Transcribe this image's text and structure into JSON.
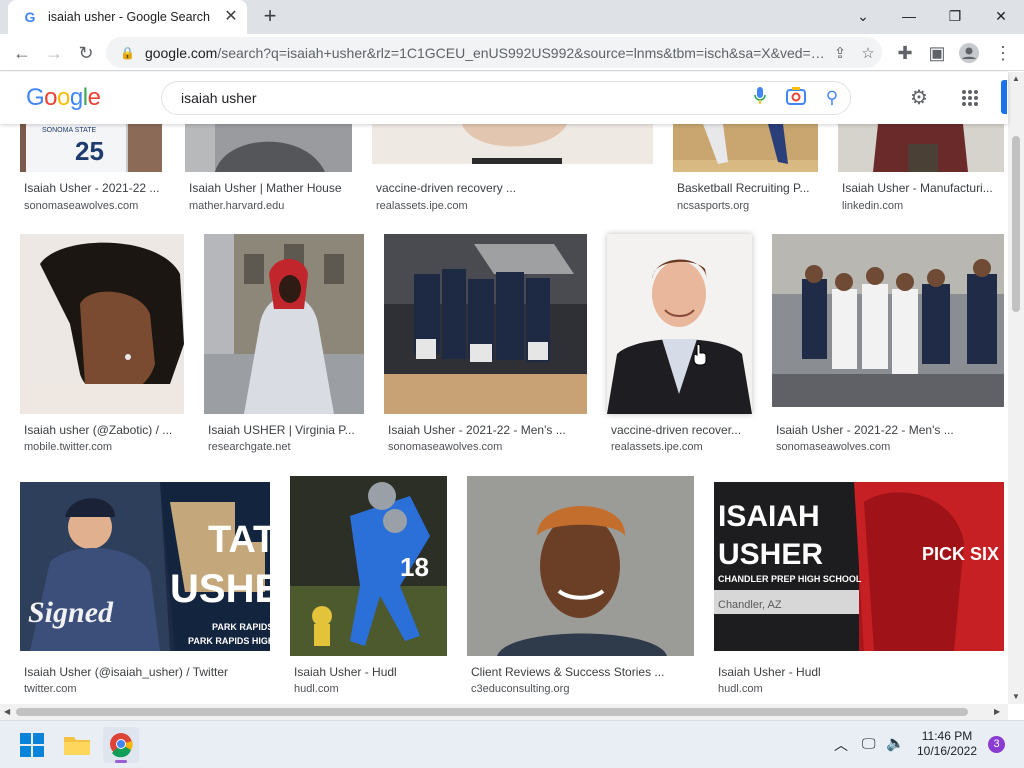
{
  "browser": {
    "tab_title": "isaiah usher - Google Search",
    "tab_close": "✕",
    "new_tab": "+",
    "address_domain": "google.com",
    "address_rest": "/search?q=isaiah+usher&rlz=1C1GCEU_enUS992US992&source=lnms&tbm=isch&sa=X&ved=…"
  },
  "google": {
    "query": "isaiah usher"
  },
  "results": {
    "row1": [
      {
        "title": "Isaiah Usher - 2021-22 ...",
        "source": "sonomaseawolves.com"
      },
      {
        "title": "Isaiah Usher | Mather House",
        "source": "mather.harvard.edu"
      },
      {
        "title": "vaccine-driven recovery ...",
        "source": "realassets.ipe.com"
      },
      {
        "title": "Basketball Recruiting P...",
        "source": "ncsasports.org"
      },
      {
        "title": "Isaiah Usher - Manufacturi...",
        "source": "linkedin.com"
      }
    ],
    "row2": [
      {
        "title": "Isaiah usher (@Zabotic) / ...",
        "source": "mobile.twitter.com"
      },
      {
        "title": "Isaiah USHER | Virginia P...",
        "source": "researchgate.net"
      },
      {
        "title": "Isaiah Usher - 2021-22 - Men's ...",
        "source": "sonomaseawolves.com"
      },
      {
        "title": "vaccine-driven recover...",
        "source": "realassets.ipe.com"
      },
      {
        "title": "Isaiah Usher - 2021-22 - Men's ...",
        "source": "sonomaseawolves.com"
      }
    ],
    "row3": [
      {
        "title": "Isaiah Usher (@isaiah_usher) / Twitter",
        "source": "twitter.com"
      },
      {
        "title": "Isaiah Usher - Hudl",
        "source": "hudl.com"
      },
      {
        "title": "Client Reviews & Success Stories ...",
        "source": "c3educonsulting.org"
      },
      {
        "title": "Isaiah Usher - Hudl",
        "source": "hudl.com"
      }
    ]
  },
  "image_text": {
    "jersey_number": "25",
    "jersey_school": "SONOMA STATE",
    "tate": "TAT",
    "usher_big": "USHE",
    "signed": "Signed",
    "park_rapids": "PARK RAPIDS",
    "park_rapids_high": "PARK RAPIDS HIGH S",
    "jersey_18": "18",
    "isaiah": "ISAIAH",
    "usher": "USHER",
    "chandler": "CHANDLER PREP HIGH SCHOOL",
    "chandler_az": "Chandler, AZ",
    "pick_six": "PICK SIX"
  },
  "taskbar": {
    "time": "11:46 PM",
    "date": "10/16/2022",
    "notification_count": "3"
  },
  "colors": {
    "google_blue": "#4285f4",
    "google_red": "#ea4335",
    "google_yellow": "#fbbc05",
    "google_green": "#34a853",
    "accent": "#1a73e8"
  }
}
